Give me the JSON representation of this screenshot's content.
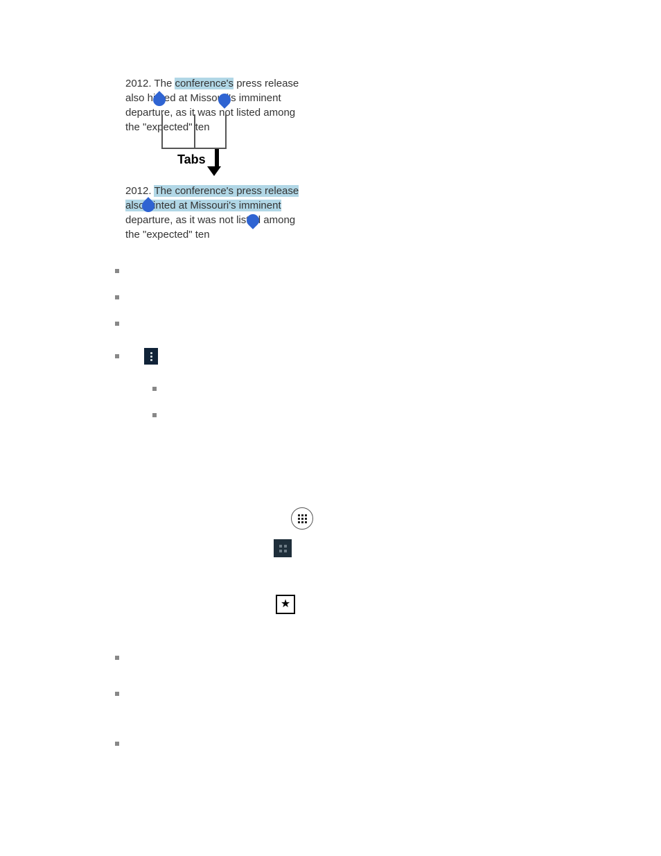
{
  "figure": {
    "snippet1_a": "2012. The ",
    "snippet1_hl": "conference's",
    "snippet1_b": " press release also hinted at Missouri's imminent departure, as it was not listed among the \"expected\" ten",
    "snippet2_a": "2012. ",
    "snippet2_hl": "The conference's press release also hinted at Missouri's imminent",
    "snippet2_b": " departure, as it was not listed among the \"expected\" ten",
    "tabs_label": "Tabs"
  },
  "outline": {
    "items": [
      {
        "level": 0,
        "label": ""
      },
      {
        "level": 0,
        "label": ""
      },
      {
        "level": 0,
        "label": ""
      },
      {
        "level": 0,
        "label": "",
        "icon": "kebab"
      },
      {
        "level": 1,
        "label": ""
      },
      {
        "level": 1,
        "label": ""
      }
    ]
  },
  "lone_icons": {
    "apps": "apps-grid-icon",
    "block": "dark-grid-icon",
    "star": "star-box-icon"
  },
  "outline2": {
    "items": [
      {
        "label": ""
      },
      {
        "label": ""
      },
      {
        "label": ""
      }
    ]
  }
}
